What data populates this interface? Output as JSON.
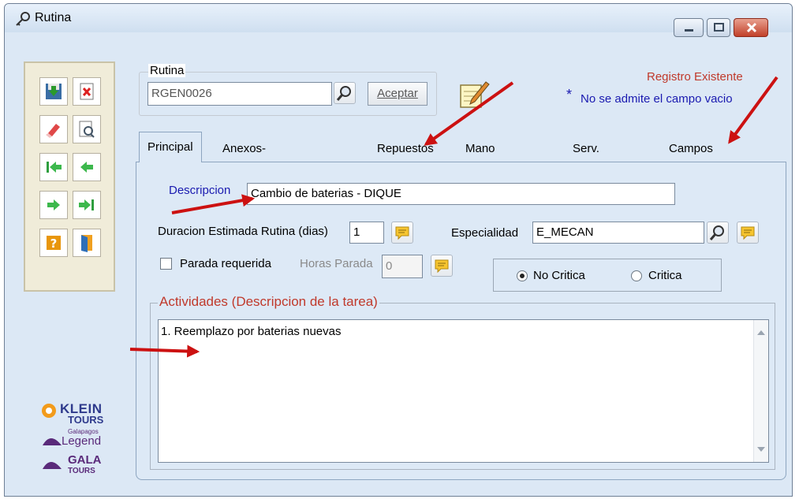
{
  "window": {
    "title": "Rutina"
  },
  "rutina_group": {
    "label": "Rutina",
    "code_value": "RGEN0026",
    "accept_label": "Aceptar"
  },
  "status": {
    "registro": "Registro Existente",
    "asterisk": "*",
    "note": "No se admite el campo vacio"
  },
  "tabs": [
    {
      "label": "Principal",
      "active": true
    },
    {
      "label": "Anexos-Requerimientos"
    },
    {
      "label": "Repuestos"
    },
    {
      "label": "Mano de Obra"
    },
    {
      "label": "Serv. Externos"
    },
    {
      "label": "Campos Pers."
    }
  ],
  "form": {
    "descripcion_label": "Descripcion",
    "descripcion_value": "Cambio de baterias - DIQUE",
    "duracion_label": "Duracion Estimada Rutina (dias)",
    "duracion_value": "1",
    "especialidad_label": "Especialidad",
    "especialidad_value": "E_MECAN",
    "parada_label": "Parada requerida",
    "horas_label": "Horas Parada",
    "horas_value": "0",
    "no_critica_label": "No Critica",
    "critica_label": "Critica",
    "actividades_label": "Actividades (Descripcion de la tarea)",
    "actividades_value": "1. Reemplazo por baterias nuevas"
  },
  "logos": {
    "klein": "KLEIN",
    "tours": "TOURS",
    "galapagos": "Galapagos",
    "legend": "Legend",
    "gala": "GALA"
  },
  "colors": {
    "red_text": "#c0392b",
    "blue_label": "#1a1ab0",
    "arrow": "#cc1111",
    "panel_bg": "#dde9f6"
  }
}
